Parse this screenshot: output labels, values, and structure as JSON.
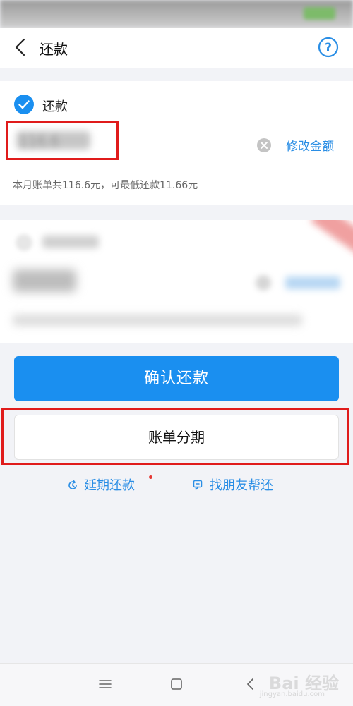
{
  "header": {
    "title": "还款",
    "back_icon": "chevron-left-icon",
    "help_icon": "help-circle-icon"
  },
  "repay_card": {
    "checkbox_label": "还款",
    "checked": true,
    "amount_value": "116.6",
    "edit_amount_label": "修改金额",
    "bill_info": "本月账单共116.6元，可最低还款11.66元"
  },
  "actions": {
    "confirm_label": "确认还款",
    "installment_label": "账单分期"
  },
  "links": {
    "extend_label": "延期还款",
    "friend_label": "找朋友帮还"
  },
  "watermark": {
    "text": "Bai 经验",
    "sub": "jingyan.baidu.com"
  },
  "colors": {
    "accent": "#1a8ff0",
    "highlight": "#e01b1b"
  }
}
